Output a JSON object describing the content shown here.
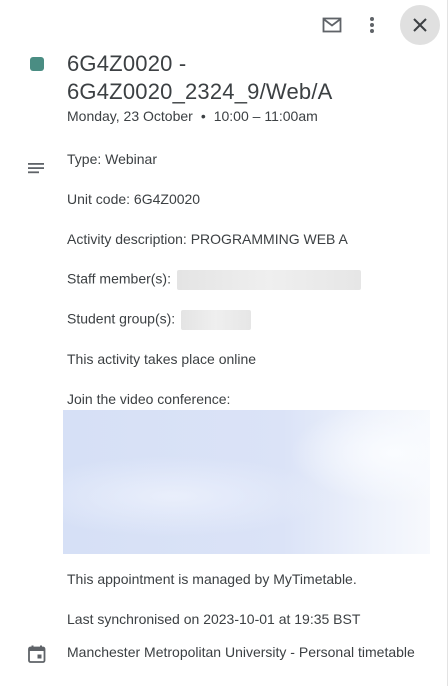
{
  "toolbar": {
    "email_icon": "email-icon",
    "more_icon": "more-vert-icon",
    "close_icon": "close-icon"
  },
  "event": {
    "color": "#4a8d83",
    "title_line1": "6G4Z0020 -",
    "title_line2": "6G4Z0020_2324_9/Web/A",
    "date": "Monday, 23 October",
    "separator": "•",
    "time": "10:00 – 11:00am"
  },
  "description": {
    "icon": "description-lines-icon",
    "type": "Type: Webinar",
    "unit_code": "Unit code: 6G4Z0020",
    "activity": "Activity description: PROGRAMMING   WEB A",
    "staff_label": "Staff member(s):",
    "student_label": "Student group(s):",
    "online": "This activity takes place online",
    "join": "Join the video conference:",
    "managed": "This appointment is managed by MyTimetable.",
    "sync": "Last synchronised on 2023-10-01 at 19:35 BST"
  },
  "calendar": {
    "icon": "calendar-icon",
    "source": "Manchester Metropolitan University - Personal timetable"
  }
}
